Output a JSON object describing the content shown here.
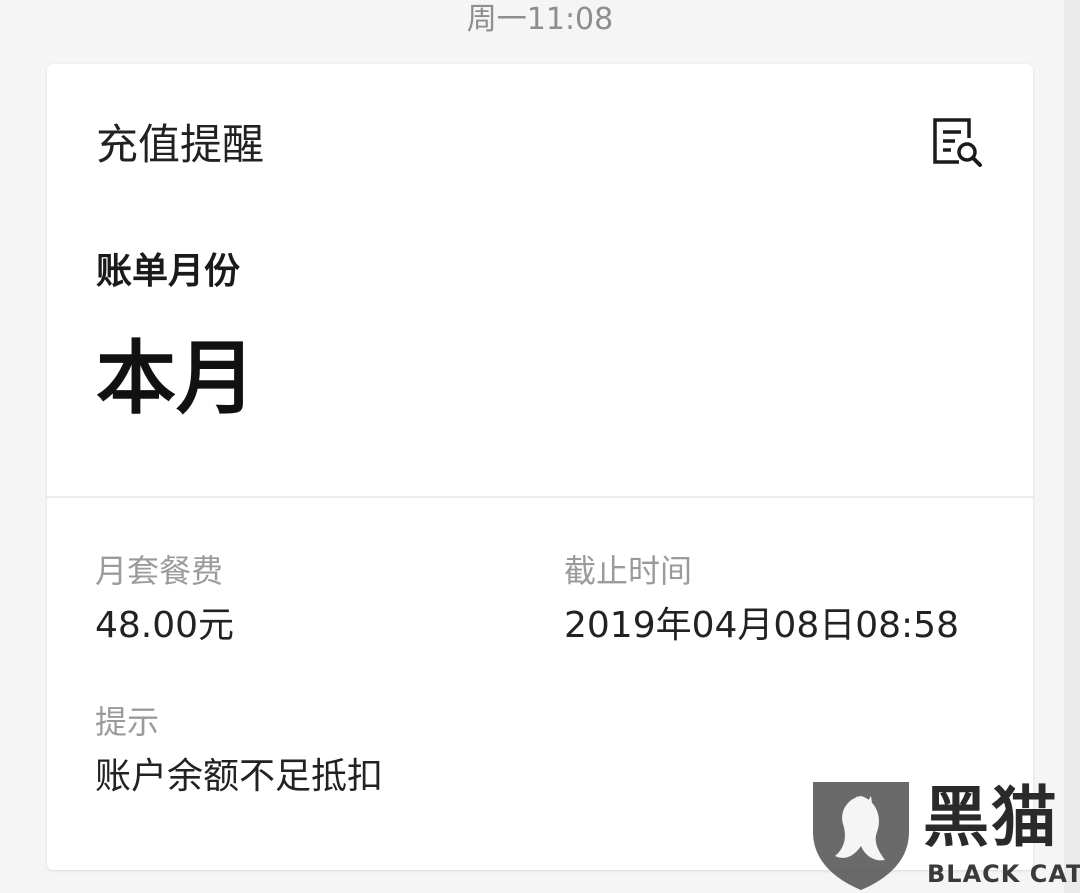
{
  "header": {
    "timestamp": "周一11:08"
  },
  "card": {
    "title": "充值提醒",
    "icon": "bill-search-icon",
    "bill_month": {
      "label": "账单月份",
      "value": "本月"
    },
    "fields": [
      {
        "label": "月套餐费",
        "value": "48.00元"
      },
      {
        "label": "截止时间",
        "value": "2019年04月08日08:58"
      },
      {
        "label": "提示",
        "value": "账户余额不足抵扣"
      }
    ]
  },
  "watermark": {
    "name_cn": "黑猫",
    "name_en": "BLACK CAT",
    "icon": "black-cat-shield-logo-icon"
  }
}
